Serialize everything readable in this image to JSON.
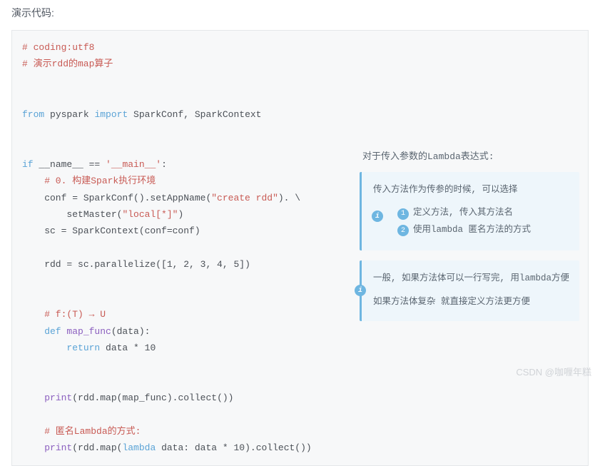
{
  "header": "演示代码:",
  "code": {
    "l1": "# coding:utf8",
    "l2": "# 演示rdd的map算子",
    "l3_from": "from",
    "l3_pkg": " pyspark ",
    "l3_import": "import",
    "l3_rest": " SparkConf, SparkContext",
    "l4_if": "if",
    "l4_name": " __name__ ",
    "l4_eq": "==",
    "l4_main": " '__main__'",
    "l4_colon": ":",
    "l5": "    # 0. 构建Spark执行环境",
    "l6a": "    conf = SparkConf().setAppName(",
    "l6b": "\"create rdd\"",
    "l6c": "). \\",
    "l7a": "        setMaster(",
    "l7b": "\"local[*]\"",
    "l7c": ")",
    "l8": "    sc = SparkContext(conf=conf)",
    "l9a": "    rdd = sc.parallelize([",
    "l9b": "1, 2, 3, 4, 5",
    "l9c": "])",
    "l10": "    # f:(T) → U",
    "l11_def": "    def",
    "l11_name": " map_func",
    "l11_rest": "(data):",
    "l12_ret": "        return",
    "l12_rest": " data * ",
    "l12_num": "10",
    "l13_pre": "    ",
    "l13_print": "print",
    "l13_rest": "(rdd.map(map_func).collect())",
    "l14": "    # 匿名Lambda的方式:",
    "l15_pre": "    ",
    "l15_print": "print",
    "l15_a": "(rdd.map(",
    "l15_lambda": "lambda",
    "l15_b": " data: data * ",
    "l15_num": "10",
    "l15_c": ").collect())"
  },
  "callout": {
    "title": "对于传入参数的Lambda表达式:",
    "box1": {
      "line1": "传入方法作为传参的时候, 可以选择",
      "opt1": "定义方法, 传入其方法名",
      "opt2": "使用lambda 匿名方法的方式"
    },
    "box2": {
      "line1": "一般, 如果方法体可以一行写完, 用lambda方便",
      "line2": "如果方法体复杂 就直接定义方法更方便"
    }
  },
  "watermark": "CSDN @咖喱年糕"
}
